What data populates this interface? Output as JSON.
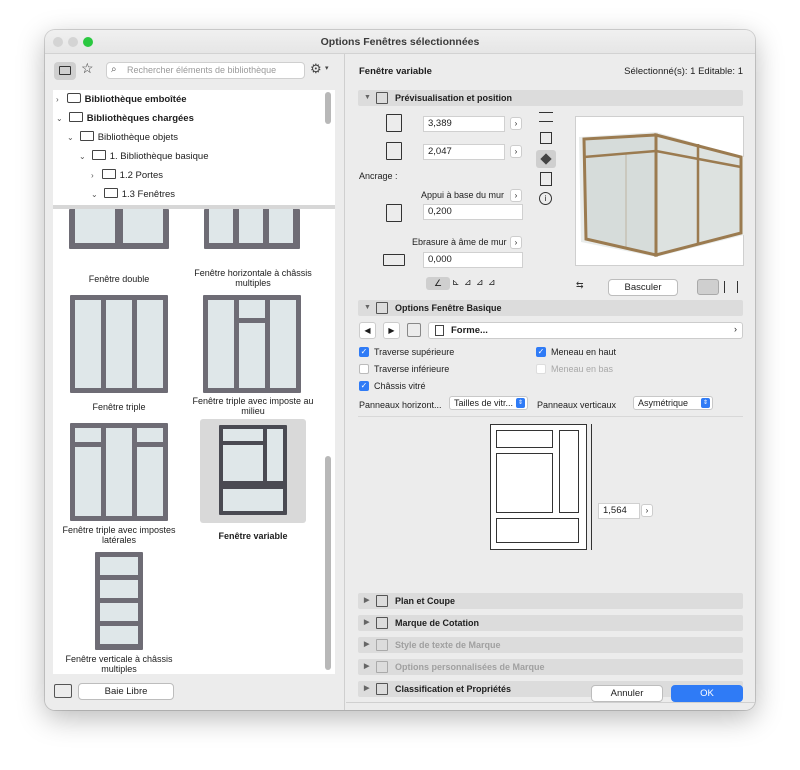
{
  "window": {
    "title": "Options Fenêtres sélectionnées"
  },
  "colors": {
    "accent": "#2f7bf6",
    "close": "#d4d4d4",
    "min": "#d4d4d4",
    "max": "#2ac840",
    "frame": "#6e6c75",
    "wood": "#9b7b50"
  },
  "library": {
    "search_placeholder": "Rechercher éléments de bibliothèque",
    "tree": [
      {
        "label": "Bibliothèque emboîtée"
      },
      {
        "label": "Bibliothèques chargées"
      },
      {
        "label": "Bibliothèque objets"
      },
      {
        "label": "1. Bibliothèque basique"
      },
      {
        "label": "1.2 Portes"
      },
      {
        "label": "1.3 Fenêtres"
      }
    ],
    "items": [
      {
        "label": "Fenêtre double"
      },
      {
        "label": "Fenêtre horizontale à châssis multiples"
      },
      {
        "label": "Fenêtre triple"
      },
      {
        "label": "Fenêtre triple avec imposte au milieu"
      },
      {
        "label": "Fenêtre triple avec impostes latérales"
      },
      {
        "label": "Fenêtre variable"
      },
      {
        "label": "Fenêtre verticale à châssis multiples"
      }
    ],
    "footer_button": "Baie Libre"
  },
  "header": {
    "object_name": "Fenêtre variable",
    "selection_info": "Sélectionné(s): 1 Editable: 1"
  },
  "preview": {
    "section": "Prévisualisation et position",
    "width": "3,389",
    "height": "2,047",
    "anchor_label": "Ancrage :",
    "sill_label": "Appui à base du mur",
    "sill_value": "0,200",
    "reveal_label": "Ebrasure à âme de mur",
    "reveal_value": "0,000",
    "flip_button": "Basculer",
    "anchor_glyphs": [
      "∠",
      "⊾",
      "⊿",
      "⊿",
      "⊿"
    ]
  },
  "basic": {
    "section": "Options Fenêtre Basique",
    "nav_label": "Forme...",
    "checks": [
      {
        "label": "Traverse supérieure",
        "checked": true,
        "enabled": true
      },
      {
        "label": "Meneau en haut",
        "checked": true,
        "enabled": true
      },
      {
        "label": "Traverse inférieure",
        "checked": false,
        "enabled": true
      },
      {
        "label": "Meneau en bas",
        "checked": false,
        "enabled": false
      },
      {
        "label": "Châssis vitré",
        "checked": true,
        "enabled": true
      }
    ],
    "horiz_label": "Panneaux horizont...",
    "horiz_value": "Tailles de vitr...",
    "vert_label": "Panneaux verticaux",
    "vert_value": "Asymétrique",
    "dim_value": "1,564"
  },
  "sections": [
    {
      "label": "Plan et Coupe",
      "enabled": true
    },
    {
      "label": "Marque de Cotation",
      "enabled": true
    },
    {
      "label": "Style de texte de Marque",
      "enabled": false
    },
    {
      "label": "Options personnalisées de Marque",
      "enabled": false
    },
    {
      "label": "Classification et Propriétés",
      "enabled": true
    }
  ],
  "footer": {
    "cancel": "Annuler",
    "ok": "OK"
  }
}
